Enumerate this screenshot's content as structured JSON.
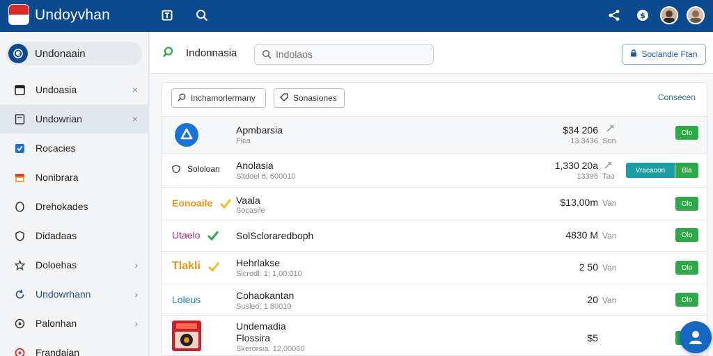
{
  "app": {
    "title": "Undoyvhan"
  },
  "sidebar": {
    "header": "Undonaain",
    "items": [
      {
        "label": "Undoasia",
        "trail": "×"
      },
      {
        "label": "Undowrian",
        "trail": "×"
      },
      {
        "label": "Rocacies",
        "trail": ""
      },
      {
        "label": "Nonibrara",
        "trail": ""
      },
      {
        "label": "Drehokades",
        "trail": ""
      },
      {
        "label": "Didadaas",
        "trail": ""
      },
      {
        "label": "Doloehas",
        "trail": "›"
      },
      {
        "label": "Undowrhann",
        "trail": "›"
      },
      {
        "label": "Palonhan",
        "trail": "›"
      },
      {
        "label": "Frandaian",
        "trail": ""
      }
    ]
  },
  "main": {
    "title": "Indonnasia",
    "search_placeholder": "Indolaos",
    "top_button": "Soclandie Ftan",
    "filters": [
      "Inchamorlermany",
      "Sonasiones"
    ],
    "card_link": "Consecen",
    "rows": [
      {
        "logo": "",
        "name": "Apmbarsia",
        "sub": "Fica",
        "price": "$34 206",
        "price_sub": "13.3436",
        "unit": "",
        "unit_sub": "Son",
        "btn": "Olo",
        "teal": ""
      },
      {
        "logo": "Sololoan",
        "name": "Anolasia",
        "sub": "Sitdoel 6; 600010",
        "price": "1,330 20a",
        "price_sub": "13396",
        "unit": "",
        "unit_sub": "Tao",
        "btn": "Bla",
        "teal": "Vracaoon"
      },
      {
        "logo": "Eonoaile",
        "name": "Vaala",
        "sub": "Socasile",
        "price": "$13,00m",
        "price_sub": "",
        "unit": "Van",
        "unit_sub": "",
        "btn": "Olo",
        "teal": ""
      },
      {
        "logo": "Utaelo",
        "name": "SolScloraredboph",
        "sub": "",
        "price": "4830 M",
        "price_sub": "",
        "unit": "Van",
        "unit_sub": "",
        "btn": "Olo",
        "teal": ""
      },
      {
        "logo": "Tlakli",
        "name": "Hehrlakse",
        "sub": "Sicrodl: 1; 1,00:010",
        "price": "2 50",
        "price_sub": "",
        "unit": "Van",
        "unit_sub": "",
        "btn": "Olo",
        "teal": ""
      },
      {
        "logo": "Loleus",
        "name": "Cohaokantan",
        "sub": "Susleo; 1 80010",
        "price": "20",
        "price_sub": "",
        "unit": "Van",
        "unit_sub": "",
        "btn": "Olo",
        "teal": ""
      },
      {
        "logo": "",
        "name": "Undemadia",
        "name2": "Flossira",
        "sub": "Skerorsia: 12,00060",
        "price": "$5",
        "price_sub": "",
        "unit": "",
        "unit_sub": "",
        "btn": "",
        "teal": ""
      }
    ]
  },
  "colors": {
    "topbar": "#0b4a8f",
    "accent_green": "#2ea84a",
    "accent_teal": "#1a9ea2"
  }
}
